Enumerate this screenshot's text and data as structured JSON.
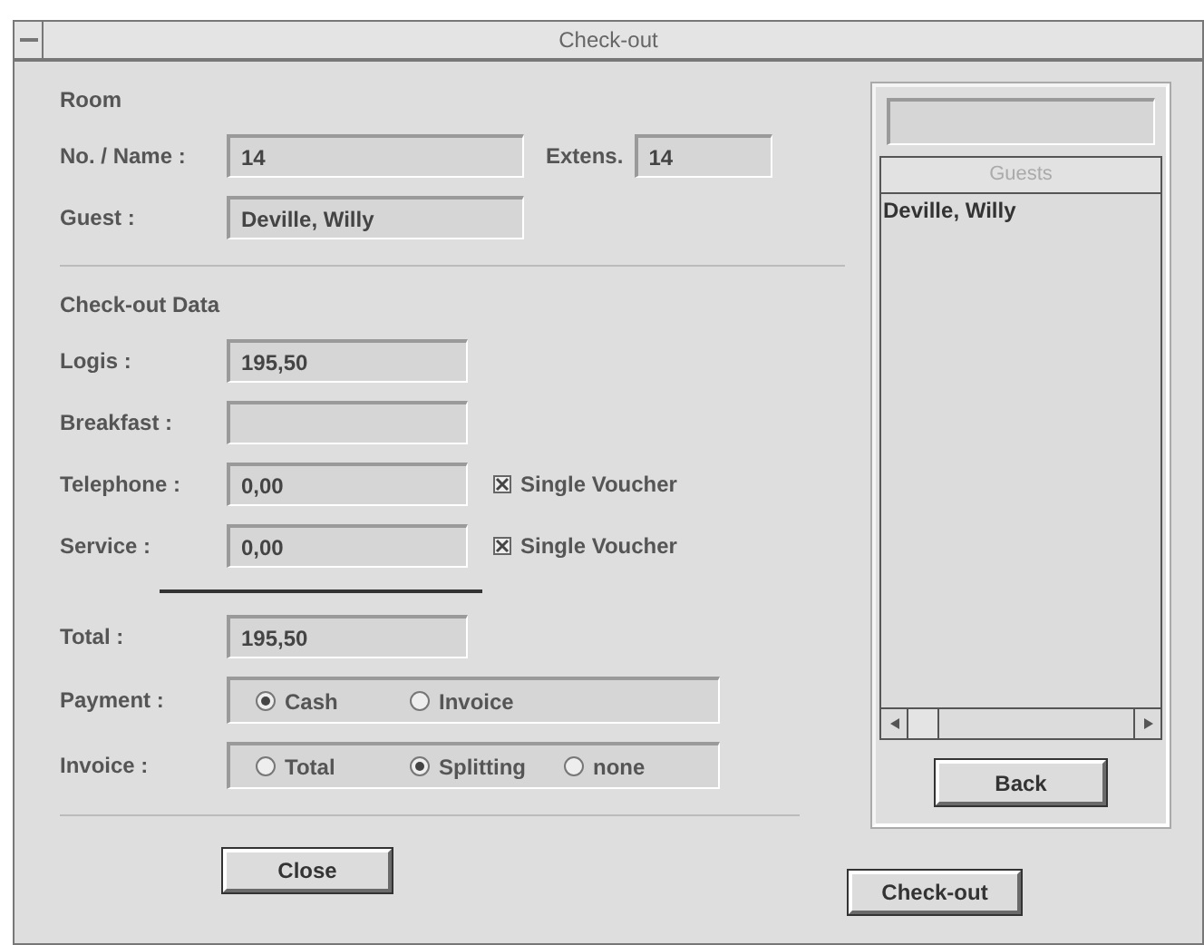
{
  "window": {
    "title": "Check-out"
  },
  "room": {
    "heading": "Room",
    "name_row": {
      "label": "No. / Name :",
      "value": "14"
    },
    "extension": {
      "label": "Extens.",
      "value": "14"
    },
    "guest_row": {
      "label": "Guest :",
      "value": "Deville, Willy"
    }
  },
  "checkout_data": {
    "heading": "Check-out Data",
    "rows": [
      {
        "kind": "field",
        "label": "Logis :",
        "value": "195,50"
      },
      {
        "kind": "field",
        "label": "Breakfast :"
      },
      {
        "kind": "field",
        "label": "Telephone :",
        "value": "0,00",
        "voucher": {
          "label": "Single Voucher",
          "checked": true
        }
      },
      {
        "kind": "field",
        "label": "Service :",
        "value": "0,00",
        "voucher": {
          "label": "Single Voucher",
          "checked": true
        }
      },
      {
        "kind": "rule"
      },
      {
        "kind": "field",
        "label": "Total :",
        "value": "195,50"
      },
      {
        "kind": "radio",
        "label": "Payment :",
        "options": [
          {
            "label": "Cash",
            "selected": true
          },
          {
            "label": "Invoice",
            "selected": false
          }
        ]
      },
      {
        "kind": "radio",
        "label": "Invoice :",
        "options": [
          {
            "label": "Total",
            "selected": false
          },
          {
            "label": "Splitting",
            "selected": true
          },
          {
            "label": "none",
            "selected": false
          }
        ]
      }
    ]
  },
  "guests_panel": {
    "header": "Guests",
    "items": [
      "Deville, Willy"
    ],
    "back_button": "Back"
  },
  "buttons": {
    "close": "Close",
    "checkout": "Check-out"
  }
}
